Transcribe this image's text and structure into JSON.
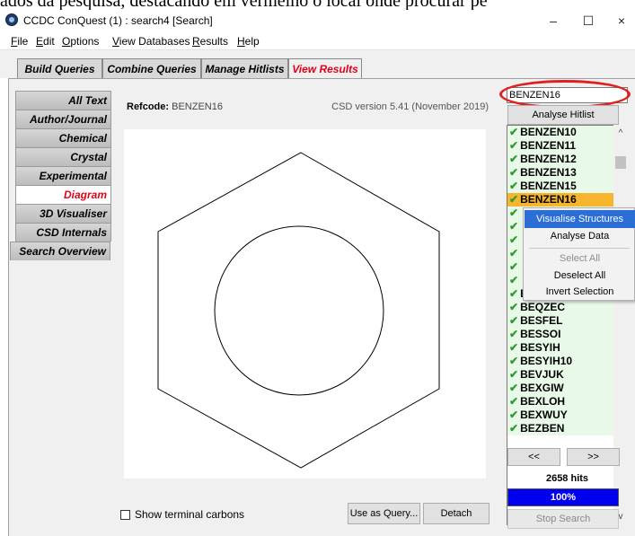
{
  "caption": "ados da pesquisa, destacando em vermelho o local onde procurar pe",
  "window": {
    "title": "CCDC ConQuest (1) : search4 [Search]",
    "minimize": "–",
    "maximize": "☐",
    "close": "×"
  },
  "menu": {
    "file": {
      "u": "F",
      "rest": "ile"
    },
    "edit": {
      "u": "E",
      "rest": "dit"
    },
    "options": {
      "u": "O",
      "rest": "ptions"
    },
    "view_databases": {
      "u": "V",
      "rest": "iew Databases"
    },
    "results": {
      "u": "R",
      "rest": "esults"
    },
    "help": {
      "u": "H",
      "rest": "elp"
    }
  },
  "tabs": {
    "build": "Build Queries",
    "combine": "Combine Queries",
    "manage": "Manage Hitlists",
    "view": "View Results"
  },
  "sidebar": {
    "all_text": "All Text",
    "author_journal": "Author/Journal",
    "chemical": "Chemical",
    "crystal": "Crystal",
    "experimental": "Experimental",
    "diagram": "Diagram",
    "visualiser": "3D Visualiser",
    "csd_internals": "CSD Internals",
    "search_overview": "Search Overview"
  },
  "refcode": {
    "label": "Refcode:",
    "value": "BENZEN16",
    "csd_version": "CSD version 5.41 (November 2019)"
  },
  "bottom": {
    "show_terminal_carbons": "Show terminal carbons",
    "use_as_query": "Use as Query...",
    "detach": "Detach"
  },
  "right": {
    "refcode_input": "BENZEN16",
    "analyse_hitlist": "Analyse Hitlist",
    "prev": "<<",
    "next": ">>",
    "hits": "2658 hits",
    "progress_label": "100%",
    "progress_fraction": 1.0,
    "stop_search": "Stop Search"
  },
  "hitlist": {
    "tick": "✔",
    "rows": [
      "BENZEN10",
      "BENZEN11",
      "BENZEN12",
      "BENZEN13",
      "BENZEN15",
      "BENZEN16",
      "",
      "",
      "",
      "",
      "",
      "",
      "BENZEN17",
      "BEQZEC",
      "BESFEL",
      "BESSOI",
      "BESYIH",
      "BESYIH10",
      "BEVJUK",
      "BEXGIW",
      "BEXLOH",
      "BEXWUY",
      "BEZBEN"
    ],
    "selected_index": 5
  },
  "context_menu": {
    "visualise_structures": "Visualise Structures",
    "analyse_data": "Analyse Data",
    "select_all": "Select All",
    "deselect_all": "Deselect All",
    "invert_selection": "Invert Selection"
  },
  "colors": {
    "active_tab_text": "#e0001a",
    "highlight_ellipse": "#e02020",
    "selected_row": "#f6b52c",
    "hit_row": "#e8f9e8",
    "progress_fill": "#0000ee",
    "menu_highlight": "#2b6fd6"
  }
}
